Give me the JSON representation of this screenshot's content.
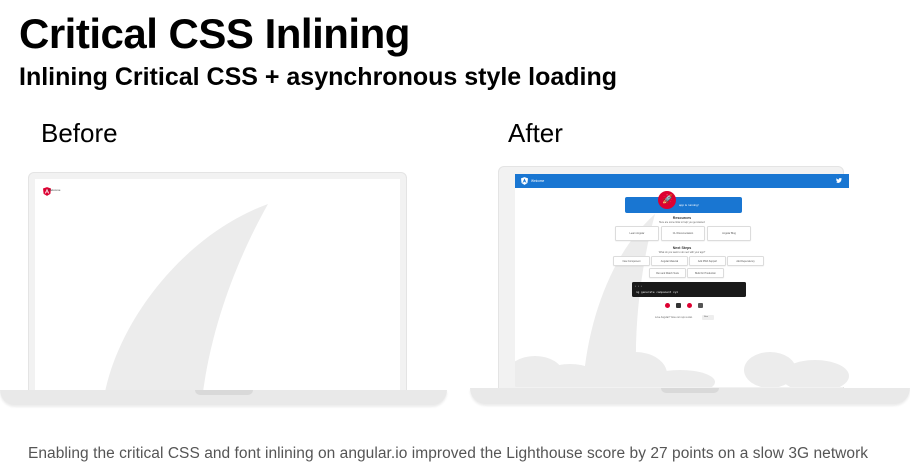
{
  "slide": {
    "title": "Critical CSS Inlining",
    "subtitle": "Inlining Critical CSS + asynchronous style loading",
    "before_label": "Before",
    "after_label": "After",
    "caption": "Enabling the critical CSS and font inlining on angular.io improved the Lighthouse score by 27 points on a slow 3G network"
  },
  "before_screen": {
    "welcome": "Welcome",
    "icons": {
      "logo": "angular-logo-icon"
    }
  },
  "after_screen": {
    "toolbar_title": "Welcome",
    "hero_text": "app is running!",
    "resources_title": "Resources",
    "resources_subtitle": "Here are some links to help you get started:",
    "resources": [
      "Learn Angular",
      "CLI Documentation",
      "Angular Blog"
    ],
    "next_steps_title": "Next Steps",
    "next_steps_subtitle": "What do you want to do next with your app?",
    "steps": [
      "New Component",
      "Angular Material",
      "Add PWA Support",
      "Add Dependency",
      "Run and Watch Tests",
      "Build for Production"
    ],
    "terminal_dots": "• • •",
    "terminal_command": "ng generate component xyz",
    "footer_text": "Love Angular? Give our repo a star.",
    "footer_badge": "Star",
    "icons": {
      "logo": "angular-logo-icon",
      "twitter": "twitter-icon",
      "rocket": "rocket-icon"
    }
  },
  "colors": {
    "toolbar": "#1976d2",
    "angular_red": "#dd0031",
    "terminal": "#1a1a1a",
    "caption": "#555555"
  }
}
